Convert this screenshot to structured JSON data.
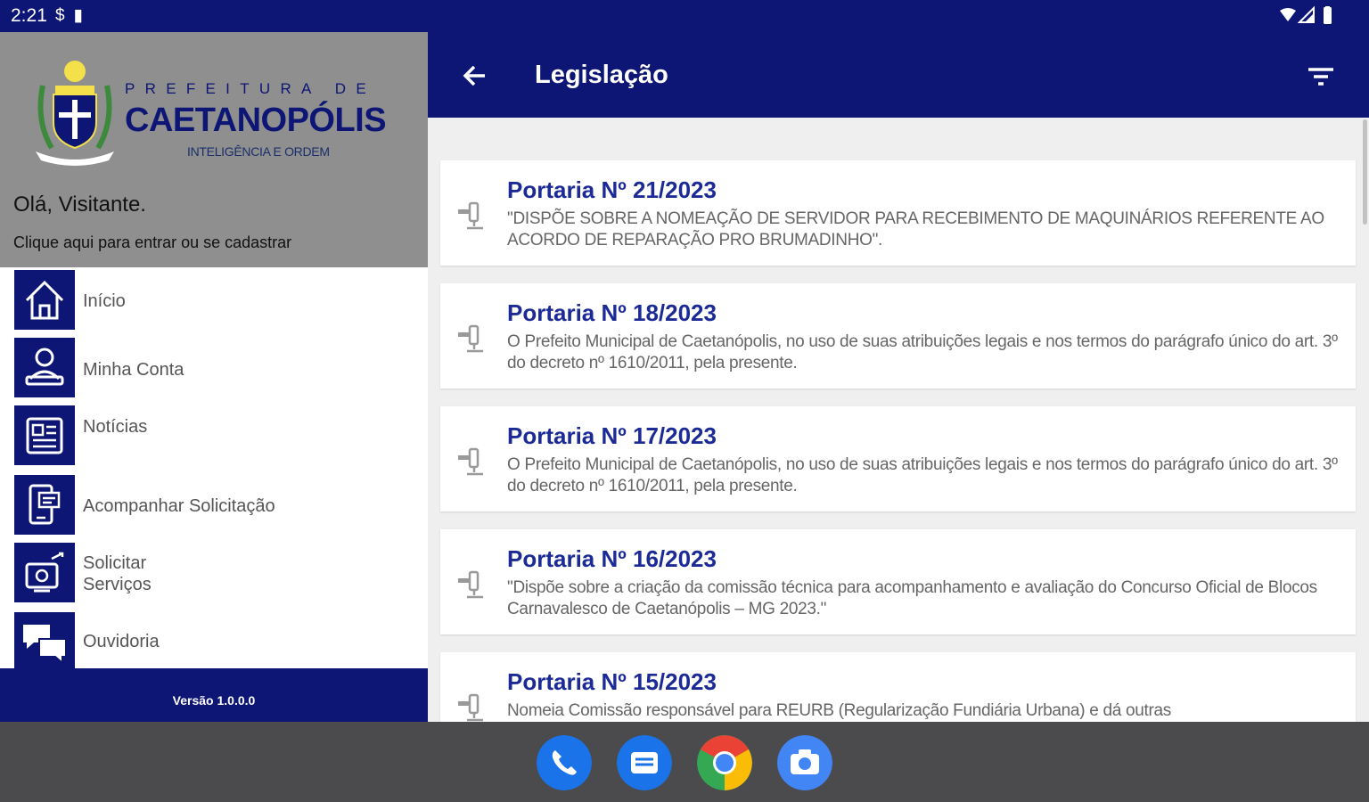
{
  "status_bar": {
    "time": "2:21",
    "left_icons": [
      "sync-icon",
      "sd-card-icon"
    ],
    "right_icons": [
      "wifi-icon",
      "signal-icon",
      "battery-icon"
    ]
  },
  "drawer": {
    "logo": {
      "prefix": "PREFEITURA DE",
      "city": "CAETANOPÓLIS",
      "motto": "INTELIGÊNCIA E ORDEM"
    },
    "greeting": "Olá, Visitante.",
    "login_hint": "Clique aqui para entrar ou se cadastrar",
    "menu": [
      {
        "label": "Início",
        "icon": "home-icon"
      },
      {
        "label": "Minha Conta",
        "icon": "account-icon"
      },
      {
        "label": "Notícias",
        "icon": "newspaper-icon"
      },
      {
        "label": "Acompanhar Solicitação",
        "icon": "tablet-form-icon"
      },
      {
        "label_line1": "Solicitar",
        "label_line2": "Serviços",
        "icon": "service-request-icon"
      },
      {
        "label": "Ouvidoria",
        "icon": "chat-icon"
      }
    ],
    "version": "Versão 1.0.0.0"
  },
  "content": {
    "title": "Legislação",
    "back_icon": "arrow-back-icon",
    "filter_icon": "filter-icon",
    "items": [
      {
        "title": "Portaria Nº 21/2023",
        "description": "\"DISPÕE SOBRE A NOMEAÇÃO DE SERVIDOR PARA RECEBIMENTO DE MAQUINÁRIOS REFERENTE AO ACORDO DE REPARAÇÃO PRO BRUMADINHO\"."
      },
      {
        "title": "Portaria Nº 18/2023",
        "description": "O Prefeito Municipal de Caetanópolis, no uso de suas atribuições legais e nos termos do parágrafo único do art. 3º do decreto nº 1610/2011, pela presente."
      },
      {
        "title": "Portaria Nº 17/2023",
        "description": "O Prefeito Municipal de Caetanópolis, no uso de suas atribuições legais e nos termos do parágrafo único do art. 3º do decreto nº 1610/2011, pela presente."
      },
      {
        "title": "Portaria Nº 16/2023",
        "description": "\"Dispõe sobre a criação da comissão técnica para acompanhamento e avaliação do Concurso Oficial de Blocos Carnavalesco de Caetanópolis – MG 2023.\""
      },
      {
        "title": "Portaria Nº 15/2023",
        "description": "Nomeia Comissão responsável para REURB (Regularização Fundiária Urbana) e dá outras"
      }
    ]
  },
  "dock": [
    {
      "app": "phone-icon",
      "color": "#1a73e8"
    },
    {
      "app": "messages-icon",
      "color": "#1a73e8"
    },
    {
      "app": "chrome-icon",
      "color": "#34a853"
    },
    {
      "app": "camera-icon",
      "color": "#4285f4"
    }
  ],
  "colors": {
    "primary": "#0d1575",
    "drawer_header": "#8f8f8f",
    "card_title": "#1c2a96",
    "navbar": "#4b4b4d"
  }
}
